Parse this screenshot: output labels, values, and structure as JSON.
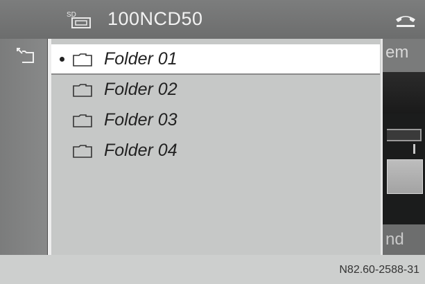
{
  "header": {
    "title": "100NCD50",
    "source_icon": "sd-card-icon",
    "phone_icon": "phone-icon"
  },
  "left_panel": {
    "back_icon": "folder-up-icon"
  },
  "folder_list": [
    {
      "label": "Folder 01",
      "selected": true,
      "icon": "folder-icon"
    },
    {
      "label": "Folder 02",
      "selected": false,
      "icon": "folder-icon"
    },
    {
      "label": "Folder 03",
      "selected": false,
      "icon": "folder-icon"
    },
    {
      "label": "Folder 04",
      "selected": false,
      "icon": "folder-icon"
    }
  ],
  "right_panel": {
    "top_text": "em",
    "bottom_text": "nd"
  },
  "footer": {
    "reference": "N82.60-2588-31"
  }
}
